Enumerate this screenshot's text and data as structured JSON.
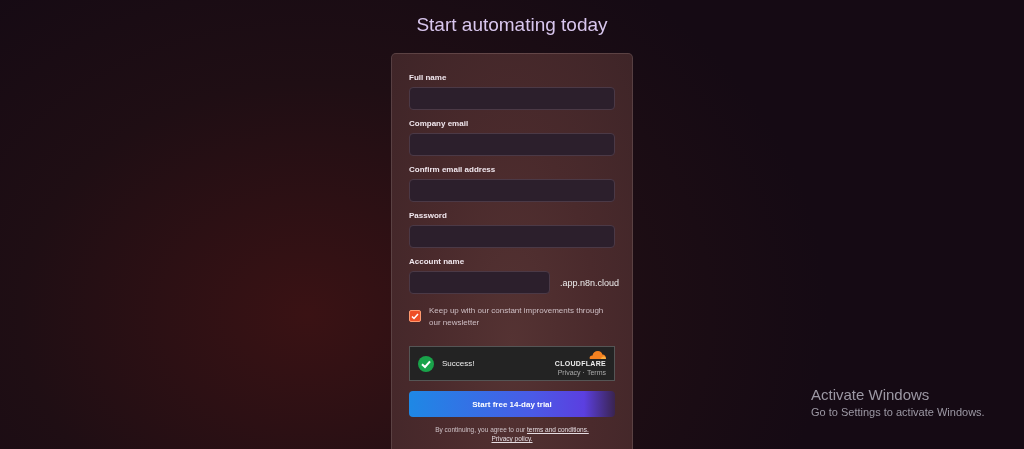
{
  "heading": "Start automating today",
  "fields": [
    {
      "label": "Full name",
      "kind": "text"
    },
    {
      "label": "Company email",
      "kind": "text"
    },
    {
      "label": "Confirm email address",
      "kind": "text"
    },
    {
      "label": "Password",
      "kind": "text"
    },
    {
      "label": "Account name",
      "kind": "domain",
      "suffix": ".app.n8n.cloud"
    }
  ],
  "newsletter": {
    "label": "Keep up with our constant improvements through our newsletter",
    "checked": true
  },
  "captcha": {
    "status": "Success!",
    "brand": "CLOUDFLARE",
    "links": [
      "Privacy",
      "Terms"
    ],
    "separator": "·"
  },
  "submit_button": "Start free 14-day trial",
  "legal": {
    "text": "By continuing, you agree to our",
    "links": [
      "terms and conditions.",
      "Privacy policy."
    ]
  },
  "os_notice": {
    "title": "Activate Windows",
    "message": "Go to Settings to activate Windows."
  }
}
